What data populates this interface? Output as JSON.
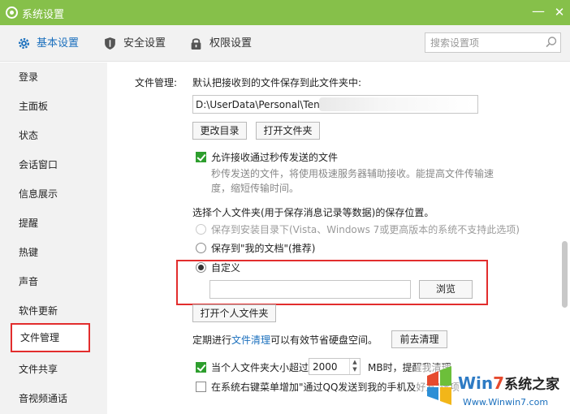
{
  "window": {
    "title": "系统设置",
    "minimize_symbol": "—",
    "close_symbol": "✕"
  },
  "tabs": [
    {
      "label": "基本设置",
      "icon": "gear-icon",
      "active": true
    },
    {
      "label": "安全设置",
      "icon": "shield-icon",
      "active": false
    },
    {
      "label": "权限设置",
      "icon": "lock-icon",
      "active": false
    }
  ],
  "search": {
    "placeholder": "搜索设置项"
  },
  "sidebar": {
    "items": [
      {
        "label": "登录"
      },
      {
        "label": "主面板"
      },
      {
        "label": "状态"
      },
      {
        "label": "会话窗口"
      },
      {
        "label": "信息展示"
      },
      {
        "label": "提醒"
      },
      {
        "label": "热键"
      },
      {
        "label": "声音"
      },
      {
        "label": "软件更新"
      },
      {
        "label": "文件管理",
        "active": true
      },
      {
        "label": "文件共享"
      },
      {
        "label": "音视频通话"
      }
    ]
  },
  "file_mgmt": {
    "section_label": "文件管理:",
    "save_desc": "默认把接收到的文件保存到此文件夹中:",
    "path_value": "D:\\UserData\\Personal\\Ten",
    "change_dir_button": "更改目录",
    "open_folder_button": "打开文件夹",
    "allow_fast_checkbox": {
      "label": "允许接收通过秒传发送的文件",
      "checked": true
    },
    "fast_desc_line1": "秒传发送的文件，将使用极速服务器辅助接收。能提高文件传输速",
    "fast_desc_line2": "度，缩短传输时间。",
    "personal_folder_title": "选择个人文件夹(用于保存消息记录等数据)的保存位置。",
    "radio_install_dir": "保存到安装目录下(Vista、Windows 7或更高版本的系统不支持此选项)",
    "radio_my_docs": "保存到\"我的文档\"(推荐)",
    "radio_custom": "自定义",
    "custom_path_value": "",
    "browse_button": "浏览",
    "open_personal_button": "打开个人文件夹",
    "clean_text_prefix": "定期进行",
    "clean_link": "文件清理",
    "clean_text_suffix": "可以有效节省硬盘空间。",
    "clean_button": "前去清理",
    "size_checkbox": {
      "label_prefix": "当个人文件夹大小超过",
      "value": "2000",
      "label_suffix": "MB时，提醒我清理",
      "checked": true
    },
    "context_menu_checkbox": {
      "label": "在系统右键菜单增加\"通过QQ发送到我的手机及好友\"选项",
      "checked": false
    }
  },
  "watermark": {
    "brand": "Win7系统之家",
    "url": "Www.Winwin7.com"
  },
  "colors": {
    "title_bar": "#86c04a",
    "accent": "#1a6fbd",
    "highlight_red": "#e22d2d",
    "check_green": "#2d9e2d"
  }
}
